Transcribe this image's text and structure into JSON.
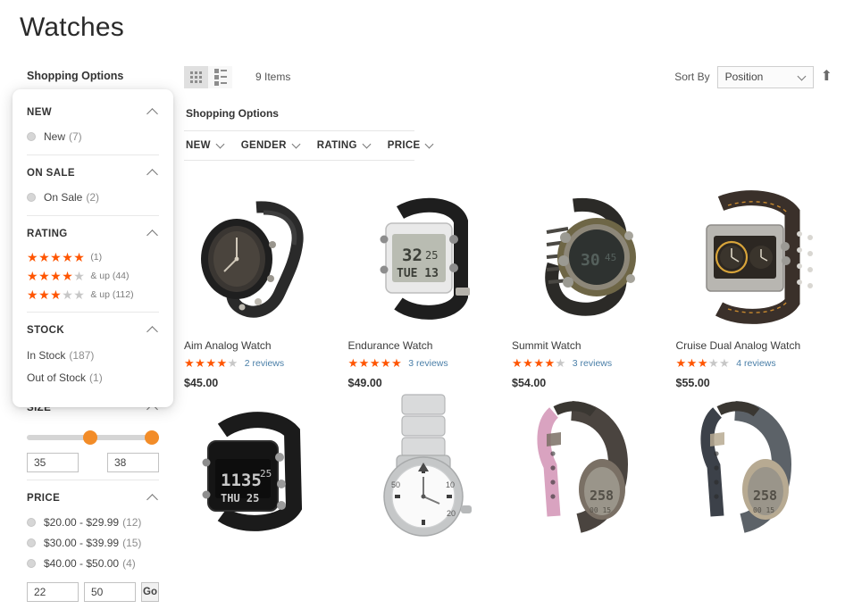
{
  "page": {
    "title": "Watches"
  },
  "sidebar": {
    "heading": "Shopping Options",
    "blocks": [
      {
        "title": "NEW",
        "type": "radio",
        "options": [
          {
            "label": "New",
            "count": "(7)"
          }
        ]
      },
      {
        "title": "ON SALE",
        "type": "radio",
        "options": [
          {
            "label": "On Sale",
            "count": "(2)"
          }
        ]
      },
      {
        "title": "RATING",
        "type": "rating",
        "options": [
          {
            "filled": 5,
            "label": "",
            "count": "(1)"
          },
          {
            "filled": 4,
            "label": "& up",
            "count": "(44)"
          },
          {
            "filled": 3,
            "label": "& up",
            "count": "(112)"
          }
        ]
      },
      {
        "title": "STOCK",
        "type": "plain",
        "options": [
          {
            "label": "In Stock",
            "count": "(187)"
          },
          {
            "label": "Out of Stock",
            "count": "(1)"
          }
        ]
      },
      {
        "title": "SIZE",
        "type": "slider",
        "min_value": "35",
        "max_value": "38"
      },
      {
        "title": "PRICE",
        "type": "price",
        "options": [
          {
            "label": "$20.00 - $29.99",
            "count": "(12)"
          },
          {
            "label": "$30.00 - $39.99",
            "count": "(15)"
          },
          {
            "label": "$40.00 - $50.00",
            "count": "(4)"
          }
        ],
        "from_value": "22",
        "to_value": "50",
        "go_label": "Go"
      }
    ]
  },
  "toolbar": {
    "grid_icon": "grid-view-icon",
    "list_icon": "list-view-icon",
    "items_count": "9 Items",
    "sort_label": "Sort By",
    "sort_value": "Position",
    "sort_direction_icon": "arrow-up-icon"
  },
  "horizontal_filters": {
    "heading": "Shopping Options",
    "items": [
      {
        "label": "NEW"
      },
      {
        "label": "GENDER"
      },
      {
        "label": "RATING"
      },
      {
        "label": "PRICE"
      }
    ]
  },
  "products": [
    {
      "name": "Aim Analog Watch",
      "filled": 4,
      "reviews": "2 reviews",
      "price": "$45.00",
      "image": "black-analog-watch"
    },
    {
      "name": "Endurance Watch",
      "filled": 4.5,
      "reviews": "3 reviews",
      "price": "$49.00",
      "image": "white-digital-watch"
    },
    {
      "name": "Summit Watch",
      "filled": 4,
      "reviews": "3 reviews",
      "price": "$54.00",
      "image": "round-digital-sport-watch"
    },
    {
      "name": "Cruise Dual Analog Watch",
      "filled": 3,
      "reviews": "4 reviews",
      "price": "$55.00",
      "image": "dual-dial-leather-watch"
    },
    {
      "name": "",
      "filled": 0,
      "reviews": "",
      "price": "",
      "image": "black-digital-square-watch"
    },
    {
      "name": "",
      "filled": 0,
      "reviews": "",
      "price": "",
      "image": "steel-bracelet-watch"
    },
    {
      "name": "",
      "filled": 0,
      "reviews": "",
      "price": "",
      "image": "pink-strap-sport-watch"
    },
    {
      "name": "",
      "filled": 0,
      "reviews": "",
      "price": "",
      "image": "gray-strap-sport-watch"
    }
  ],
  "colors": {
    "accent": "#ff5501",
    "slider": "#f28c28",
    "link": "#4a7fa8"
  }
}
